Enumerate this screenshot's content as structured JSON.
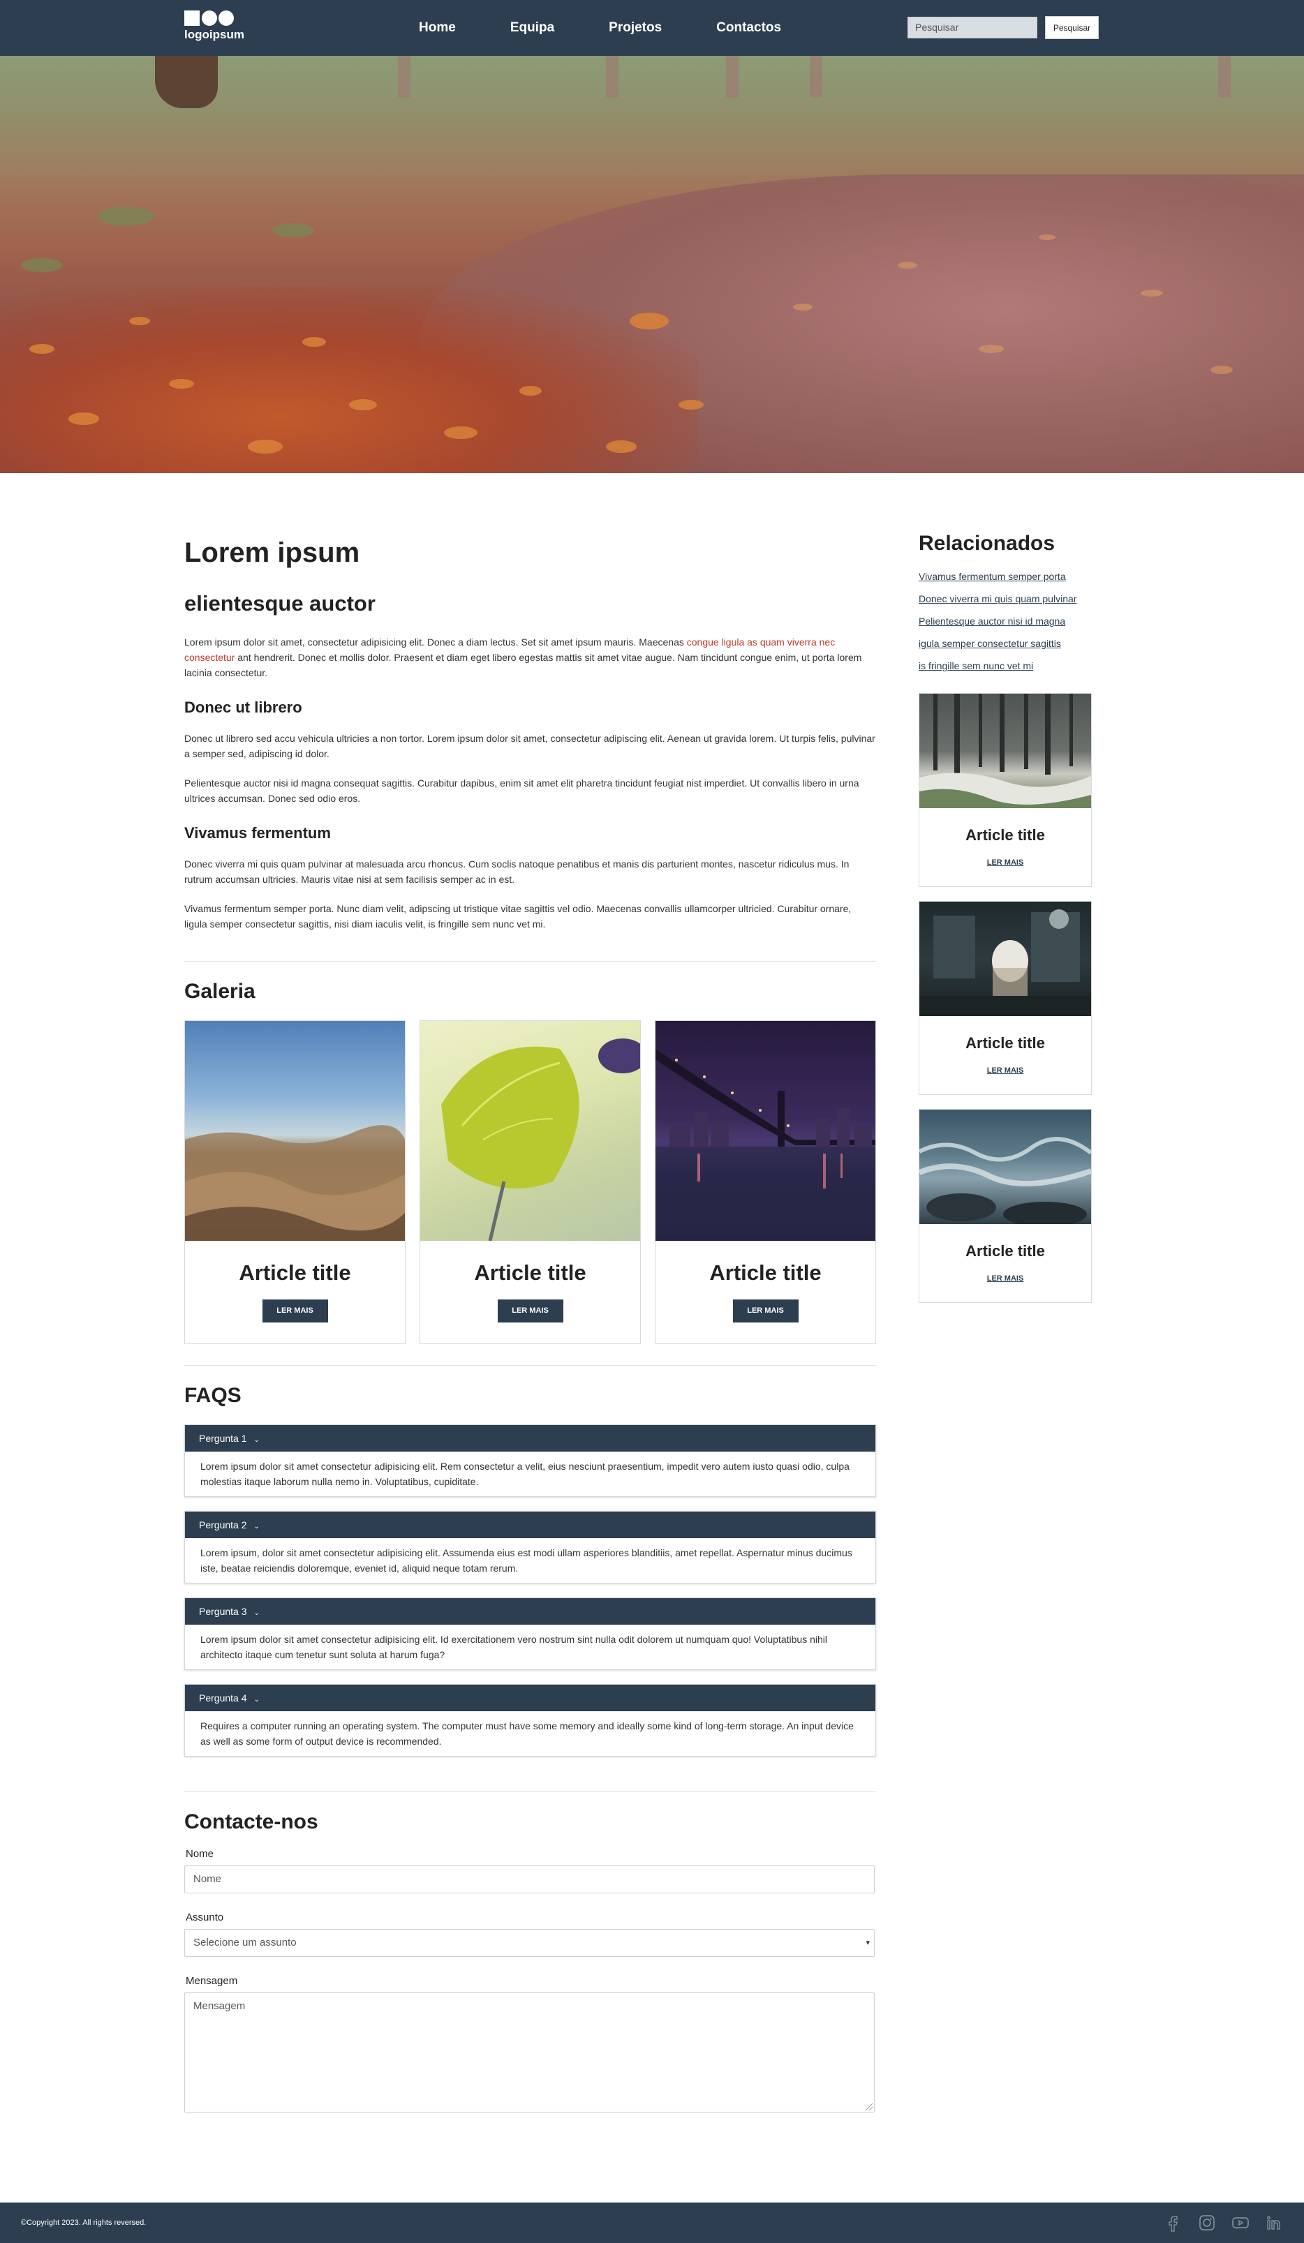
{
  "header": {
    "logo_text": "logoipsum",
    "nav": [
      "Home",
      "Equipa",
      "Projetos",
      "Contactos"
    ],
    "search_placeholder": "Pesquisar",
    "search_button": "Pesquisar"
  },
  "main": {
    "title": "Lorem ipsum",
    "subtitle": "elientesque auctor",
    "intro_before": "Lorem ipsum dolor sit amet, consectetur adipisicing elit. Donec a diam lectus. Set sit amet ipsum mauris. Maecenas ",
    "intro_link": "congue ligula as quam viverra nec consectetur",
    "intro_after": " ant hendrerit. Donec et mollis dolor. Praesent et diam eget libero egestas mattis sit amet vitae augue. Nam tincidunt congue enim, ut porta lorem lacinia consectetur.",
    "section1_title": "Donec ut librero",
    "section1_p1": "Donec ut librero sed accu vehicula ultricies a non tortor. Lorem ipsum dolor sit amet, consectetur adipiscing elit. Aenean ut gravida lorem. Ut turpis felis, pulvinar a semper sed, adipiscing id dolor.",
    "section1_p2": "Pelientesque auctor nisi id magna consequat sagittis. Curabitur dapibus, enim sit amet elit pharetra tincidunt feugiat nist imperdiet. Ut convallis libero in urna ultrices accumsan. Donec sed odio eros.",
    "section2_title": "Vivamus fermentum",
    "section2_p1": "Donec viverra mi quis quam pulvinar at malesuada arcu rhoncus. Cum soclis natoque penatibus et manis dis parturient montes, nascetur ridiculus mus. In rutrum accumsan ultricies. Mauris vitae nisi at sem facilisis semper ac in est.",
    "section2_p2": "Vivamus fermentum semper porta. Nunc diam velit, adipscing ut tristique vitae sagittis vel odio. Maecenas convallis ullamcorper ultricied. Curabitur ornare, ligula semper consectetur sagittis, nisi diam iaculis velit, is fringille sem nunc vet mi."
  },
  "gallery": {
    "title": "Galeria",
    "cards": [
      {
        "title": "Article title",
        "button": "LER MAIS",
        "image": "mountains-photo"
      },
      {
        "title": "Article title",
        "button": "LER MAIS",
        "image": "leaf-photo"
      },
      {
        "title": "Article title",
        "button": "LER MAIS",
        "image": "bridge-night-photo"
      }
    ]
  },
  "faqs": {
    "title": "FAQS",
    "items": [
      {
        "question": "Pergunta 1",
        "answer": "Lorem ipsum dolor sit amet consectetur adipisicing elit. Rem consectetur a velit, eius nesciunt praesentium, impedit vero autem iusto quasi odio, culpa molestias itaque laborum nulla nemo in. Voluptatibus, cupiditate."
      },
      {
        "question": "Pergunta 2",
        "answer": "Lorem ipsum, dolor sit amet consectetur adipisicing elit. Assumenda eius est modi ullam asperiores blanditiis, amet repellat. Aspernatur minus ducimus iste, beatae reiciendis doloremque, eveniet id, aliquid neque totam rerum."
      },
      {
        "question": "Pergunta 3",
        "answer": "Lorem ipsum dolor sit amet consectetur adipisicing elit. Id exercitationem vero nostrum sint nulla odit dolorem ut numquam quo! Voluptatibus nihil architecto itaque cum tenetur sunt soluta at harum fuga?"
      },
      {
        "question": "Pergunta 4",
        "answer": "Requires a computer running an operating system. The computer must have some memory and ideally some kind of long-term storage. An input device as well as some form of output device is recommended."
      }
    ]
  },
  "contact": {
    "title": "Contacte-nos",
    "name_label": "Nome",
    "name_placeholder": "Nome",
    "subject_label": "Assunto",
    "subject_value": "Selecione um assunto",
    "message_label": "Mensagem",
    "message_placeholder": "Mensagem"
  },
  "sidebar": {
    "title": "Relacionados",
    "links": [
      "Vivamus fermentum semper porta",
      "Donec viverra mi quis quam pulvinar",
      "Pelientesque auctor nisi id magna",
      "igula semper consectetur sagittis",
      "is fringille sem nunc vet mi"
    ],
    "cards": [
      {
        "title": "Article title",
        "link": "LER MAIS",
        "image": "snowy-forest-photo"
      },
      {
        "title": "Article title",
        "link": "LER MAIS",
        "image": "coffee-machine-photo"
      },
      {
        "title": "Article title",
        "link": "LER MAIS",
        "image": "ocean-waves-photo"
      }
    ]
  },
  "footer": {
    "copyright": "©Copyright 2023. All rights reversed.",
    "social": [
      "facebook-icon",
      "instagram-icon",
      "youtube-icon",
      "linkedin-icon"
    ]
  },
  "colors": {
    "primary": "#2c3e50",
    "link_red": "#c0392b",
    "background": "#ffffff"
  }
}
